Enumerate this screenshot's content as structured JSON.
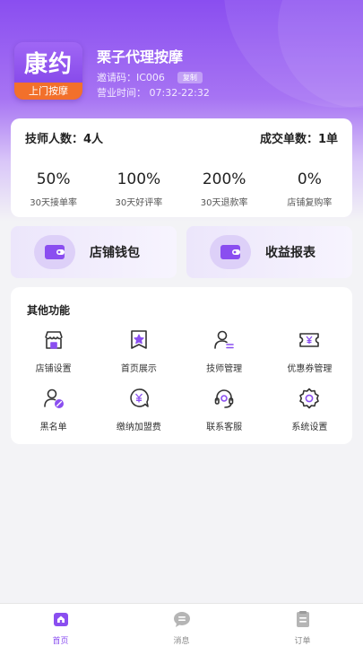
{
  "brand": {
    "logo_main": "康约",
    "logo_sub": "上门按摩",
    "accent": "#8a4ef0",
    "badge_color": "#f2702b"
  },
  "shop": {
    "name": "栗子代理按摩",
    "invite_label": "邀请码：",
    "invite_code": "IC006",
    "copy_label": "复制",
    "hours_label": "营业时间：",
    "hours": "07:32-22:32"
  },
  "summary": {
    "technicians_label": "技师人数：",
    "technicians_value": "4人",
    "orders_label": "成交单数：",
    "orders_value": "1单"
  },
  "stats": [
    {
      "value": "50%",
      "label": "30天接单率"
    },
    {
      "value": "100%",
      "label": "30天好评率"
    },
    {
      "value": "200%",
      "label": "30天退款率"
    },
    {
      "value": "0%",
      "label": "店铺复购率"
    }
  ],
  "quick": {
    "wallet": {
      "label": "店铺钱包",
      "icon": "wallet-icon"
    },
    "report": {
      "label": "收益报表",
      "icon": "wallet-icon"
    }
  },
  "functions": {
    "title": "其他功能",
    "items": [
      {
        "label": "店铺设置",
        "icon": "store-icon"
      },
      {
        "label": "首页展示",
        "icon": "star-frame-icon"
      },
      {
        "label": "技师管理",
        "icon": "user-list-icon"
      },
      {
        "label": "优惠券管理",
        "icon": "coupon-icon"
      },
      {
        "label": "黑名单",
        "icon": "user-block-icon"
      },
      {
        "label": "缴纳加盟费",
        "icon": "yuan-chat-icon"
      },
      {
        "label": "联系客服",
        "icon": "headset-icon"
      },
      {
        "label": "系统设置",
        "icon": "gear-icon"
      }
    ]
  },
  "tabbar": {
    "items": [
      {
        "label": "首页",
        "icon": "home-icon",
        "active": true
      },
      {
        "label": "消息",
        "icon": "message-icon",
        "active": false
      },
      {
        "label": "订单",
        "icon": "order-icon",
        "active": false
      }
    ]
  }
}
